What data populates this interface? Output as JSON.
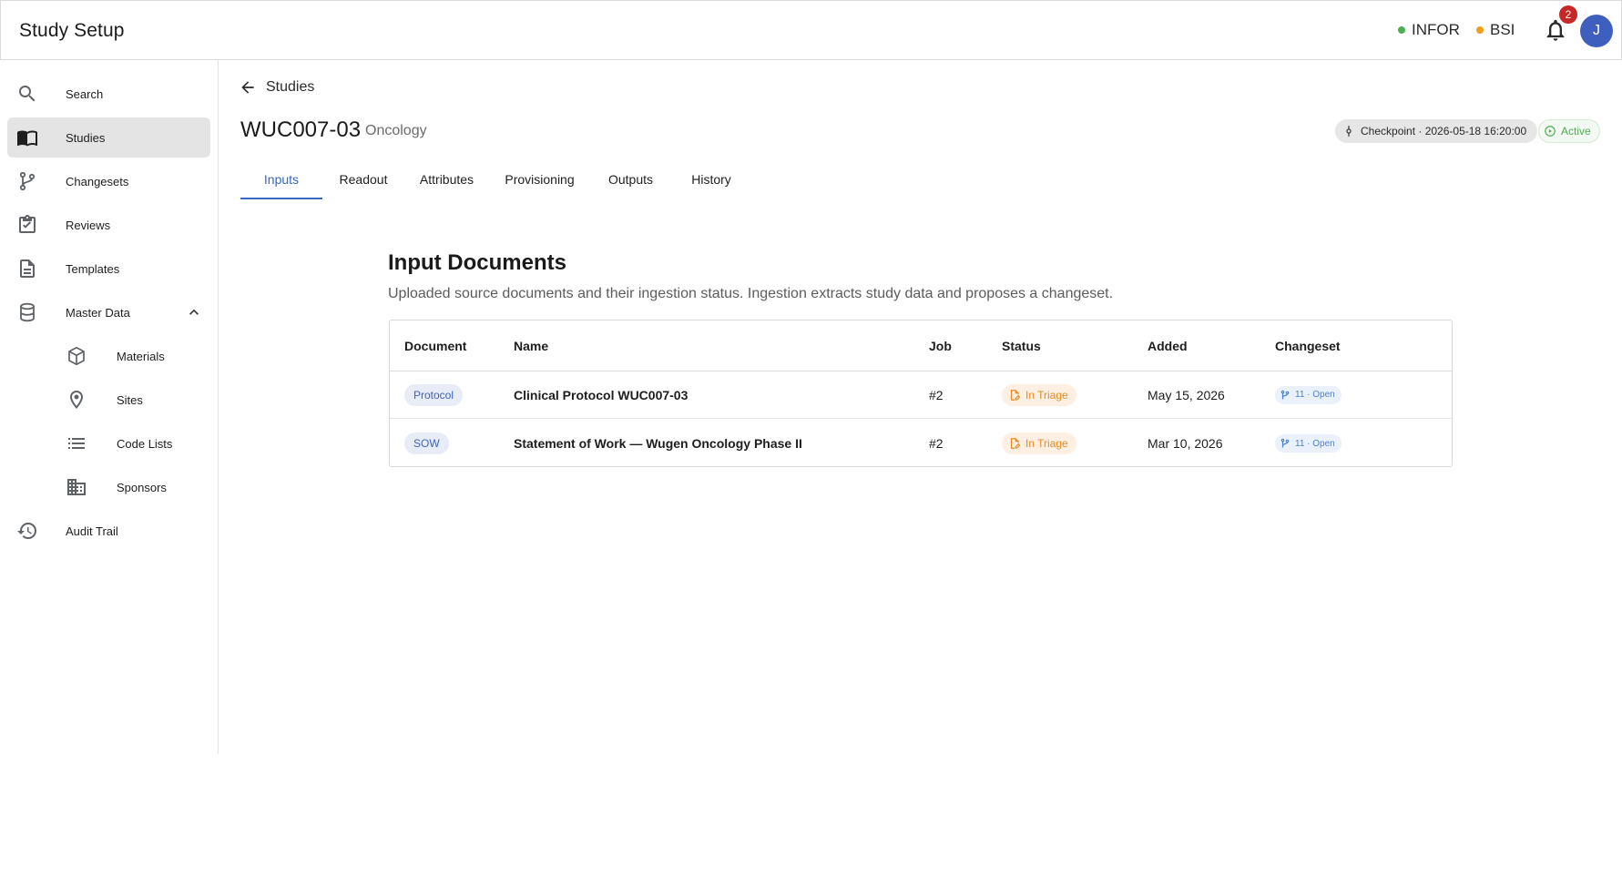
{
  "app": {
    "title": "Study Setup"
  },
  "header": {
    "systems": [
      {
        "label": "INFOR",
        "color": "#4caf50"
      },
      {
        "label": "BSI",
        "color": "#f59c1a"
      }
    ],
    "notifications_count": "2",
    "avatar_initial": "J"
  },
  "sidebar": {
    "items": [
      {
        "label": "Search",
        "icon": "search-icon"
      },
      {
        "label": "Studies",
        "icon": "book-icon",
        "active": true
      },
      {
        "label": "Changesets",
        "icon": "branch-icon"
      },
      {
        "label": "Reviews",
        "icon": "clipboard-check-icon"
      },
      {
        "label": "Templates",
        "icon": "document-icon"
      },
      {
        "label": "Master Data",
        "icon": "database-icon",
        "expanded": true
      },
      {
        "label": "Audit Trail",
        "icon": "history-icon"
      }
    ],
    "master_data_children": [
      {
        "label": "Materials",
        "icon": "cube-icon"
      },
      {
        "label": "Sites",
        "icon": "location-pin-icon"
      },
      {
        "label": "Code Lists",
        "icon": "list-icon"
      },
      {
        "label": "Sponsors",
        "icon": "building-icon"
      }
    ]
  },
  "breadcrumb": {
    "back_label": "Studies"
  },
  "study": {
    "id": "WUC007-03",
    "therapeutic_area": "Oncology",
    "checkpoint": "Checkpoint · 2026-05-18 16:20:00",
    "status": "Active",
    "status_color": "#4caf50"
  },
  "tabs": [
    {
      "label": "Inputs",
      "active": true
    },
    {
      "label": "Readout"
    },
    {
      "label": "Attributes"
    },
    {
      "label": "Provisioning"
    },
    {
      "label": "Outputs"
    },
    {
      "label": "History"
    }
  ],
  "section": {
    "title": "Input Documents",
    "description": "Uploaded source documents and their ingestion status. Ingestion extracts study data and proposes a changeset."
  },
  "table": {
    "columns": [
      "Document",
      "Name",
      "Job",
      "Status",
      "Added",
      "Changeset"
    ],
    "rows": [
      {
        "document": "Protocol",
        "name": "Clinical Protocol WUC007-03",
        "job": "#2",
        "status": "In Triage",
        "added": "May 15, 2026",
        "changeset": "11 · Open"
      },
      {
        "document": "SOW",
        "name": "Statement of Work — Wugen Oncology Phase II",
        "job": "#2",
        "status": "In Triage",
        "added": "Mar 10, 2026",
        "changeset": "11 · Open"
      }
    ]
  },
  "colors": {
    "accent": "#3a67c5",
    "triage": "#e8891f",
    "notification_badge": "#c62828"
  }
}
